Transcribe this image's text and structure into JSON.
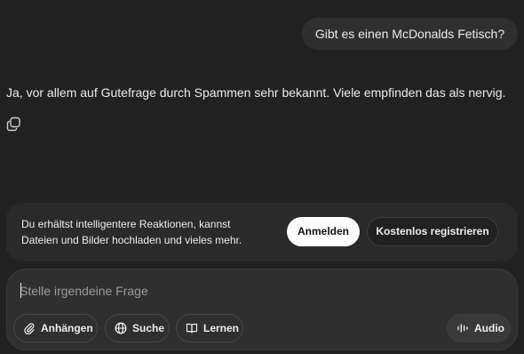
{
  "conversation": {
    "user_message": "Gibt es einen McDonalds Fetisch?",
    "assistant_message": "Ja, vor allem auf Gutefrage durch Spammen sehr bekannt. Viele empfinden das als nervig."
  },
  "banner": {
    "text": "Du erhältst intelligentere Reaktionen, kannst Dateien und Bilder hochladen und vieles mehr.",
    "login_label": "Anmelden",
    "register_label": "Kostenlos registrieren"
  },
  "composer": {
    "placeholder": "Stelle irgendeine Frage",
    "attach_label": "Anhängen",
    "search_label": "Suche",
    "learn_label": "Lernen",
    "audio_label": "Audio"
  },
  "icons": {
    "copy": "copy-icon",
    "attach": "paperclip-icon",
    "search": "globe-icon",
    "learn": "book-icon",
    "audio": "waveform-icon"
  }
}
